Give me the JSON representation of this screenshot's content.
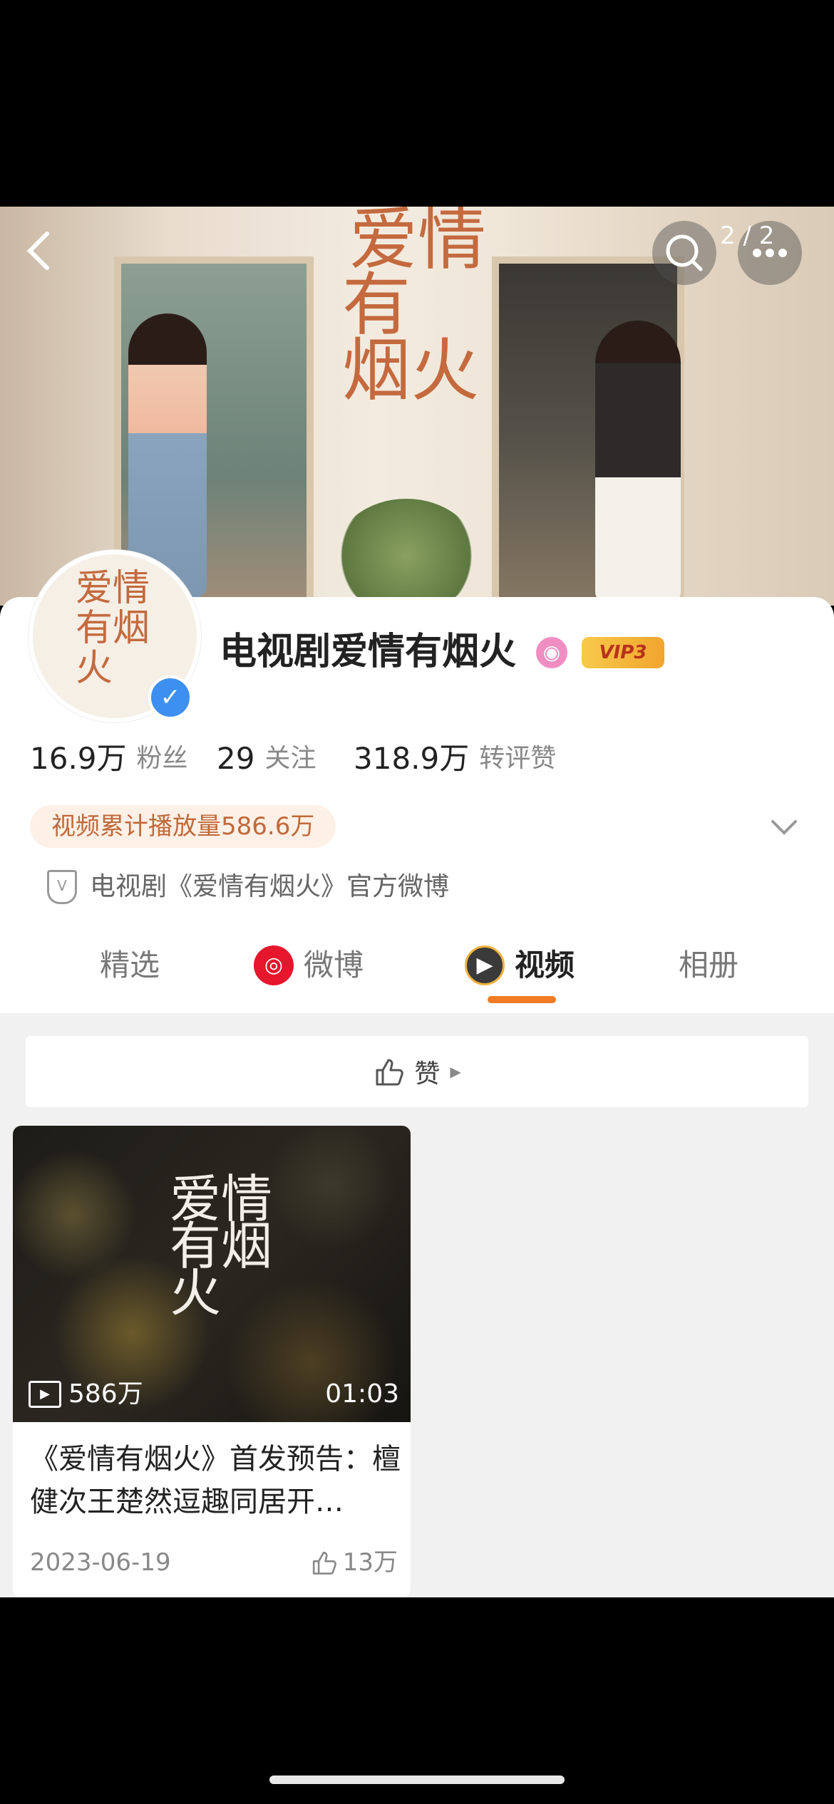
{
  "banner": {
    "title_chars": [
      "爱情",
      "有",
      "烟火"
    ],
    "page_indicator": "2 / 2"
  },
  "profile": {
    "avatar_text": "爱情有烟火",
    "name": "电视剧爱情有烟火",
    "vip_badge": "VIP3",
    "stats": [
      {
        "num": "16.9万",
        "label": "粉丝"
      },
      {
        "num": "29",
        "label": "关注"
      },
      {
        "num": "318.9万",
        "label": "转评赞"
      }
    ],
    "plays_tag": "视频累计播放量586.6万",
    "official_text": "电视剧《爱情有烟火》官方微博"
  },
  "tabs": [
    {
      "label": "精选"
    },
    {
      "label": "微博"
    },
    {
      "label": "视频"
    },
    {
      "label": "相册"
    }
  ],
  "like_bar": {
    "label": "赞"
  },
  "video": {
    "thumb_title": "爱情有烟火",
    "views": "586万",
    "duration": "01:03",
    "title": "《爱情有烟火》首发预告：檀健次王楚然逗趣同居开…",
    "date": "2023-06-19",
    "likes": "13万"
  },
  "colors": {
    "accent": "#f07b24",
    "verify": "#3d8ff0",
    "tag_text": "#c0693a"
  }
}
